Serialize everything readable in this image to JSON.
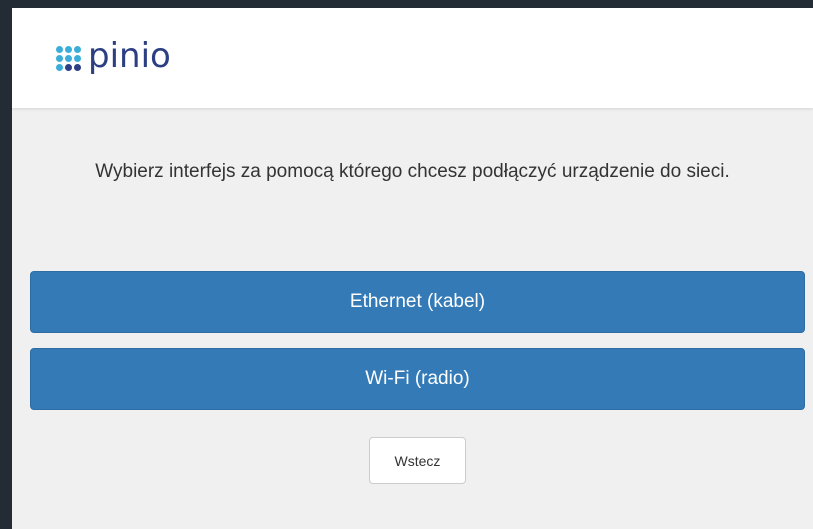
{
  "brand": {
    "name": "pinio",
    "colors": {
      "cyan": "#3aaed8",
      "navy": "#2b3f82"
    }
  },
  "prompt": "Wybierz interfejs za pomocą którego chcesz podłączyć urządzenie do sieci.",
  "options": [
    {
      "label": "Ethernet (kabel)"
    },
    {
      "label": "Wi-Fi (radio)"
    }
  ],
  "back_label": "Wstecz",
  "colors": {
    "primary": "#337ab7",
    "background": "#f0f0f0"
  }
}
